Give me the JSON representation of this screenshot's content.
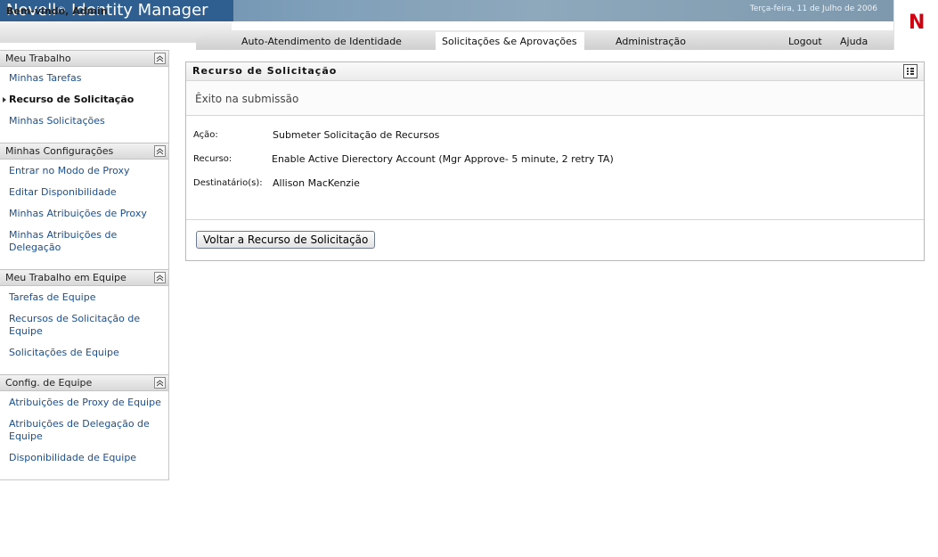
{
  "header": {
    "brand": "Novell",
    "brand_reg": "®",
    "brand_product": "Identity Manager",
    "date": "Terça-feira, 11 de Julho de 2006",
    "welcome": "Bem-vindo, Admin",
    "logo_letter": "N",
    "logo_color": "#d00010"
  },
  "nav": {
    "tabs": [
      {
        "label": "Auto-Atendimento de Identidade"
      },
      {
        "label": "Solicitações &e Aprovações",
        "active": true
      },
      {
        "label": "Administração"
      }
    ],
    "logout": "Logout",
    "help": "Ajuda"
  },
  "sidebar": {
    "sections": [
      {
        "title": "Meu Trabalho",
        "items": [
          "Minhas Tarefas",
          "Recurso de Solicitação",
          "Minhas Solicitações"
        ],
        "current": "Recurso de Solicitação"
      },
      {
        "title": "Minhas Configurações",
        "items": [
          "Entrar no Modo de Proxy",
          "Editar Disponibilidade",
          "Minhas Atribuições de Proxy",
          "Minhas Atribuições de Delegação"
        ]
      },
      {
        "title": "Meu Trabalho em Equipe",
        "items": [
          "Tarefas de Equipe",
          "Recursos de Solicitação de Equipe",
          "Solicitações de Equipe"
        ]
      },
      {
        "title": "Config. de Equipe",
        "items": [
          "Atribuições de Proxy de Equipe",
          "Atribuições de Delegação de Equipe",
          "Disponibilidade de Equipe"
        ]
      }
    ]
  },
  "panel": {
    "title": "Recurso de Solicitação",
    "success": "Êxito na submissão",
    "fields": [
      {
        "label": "Ação:",
        "value": "Submeter Solicitação de Recursos"
      },
      {
        "label": "Recurso:",
        "value": "Enable Active Dierectory Account (Mgr Approve- 5 minute, 2 retry TA)"
      },
      {
        "label": "Destinatário(s):",
        "value": "Allison MacKenzie"
      }
    ],
    "back_button": "Voltar a Recurso de Solicitação"
  }
}
